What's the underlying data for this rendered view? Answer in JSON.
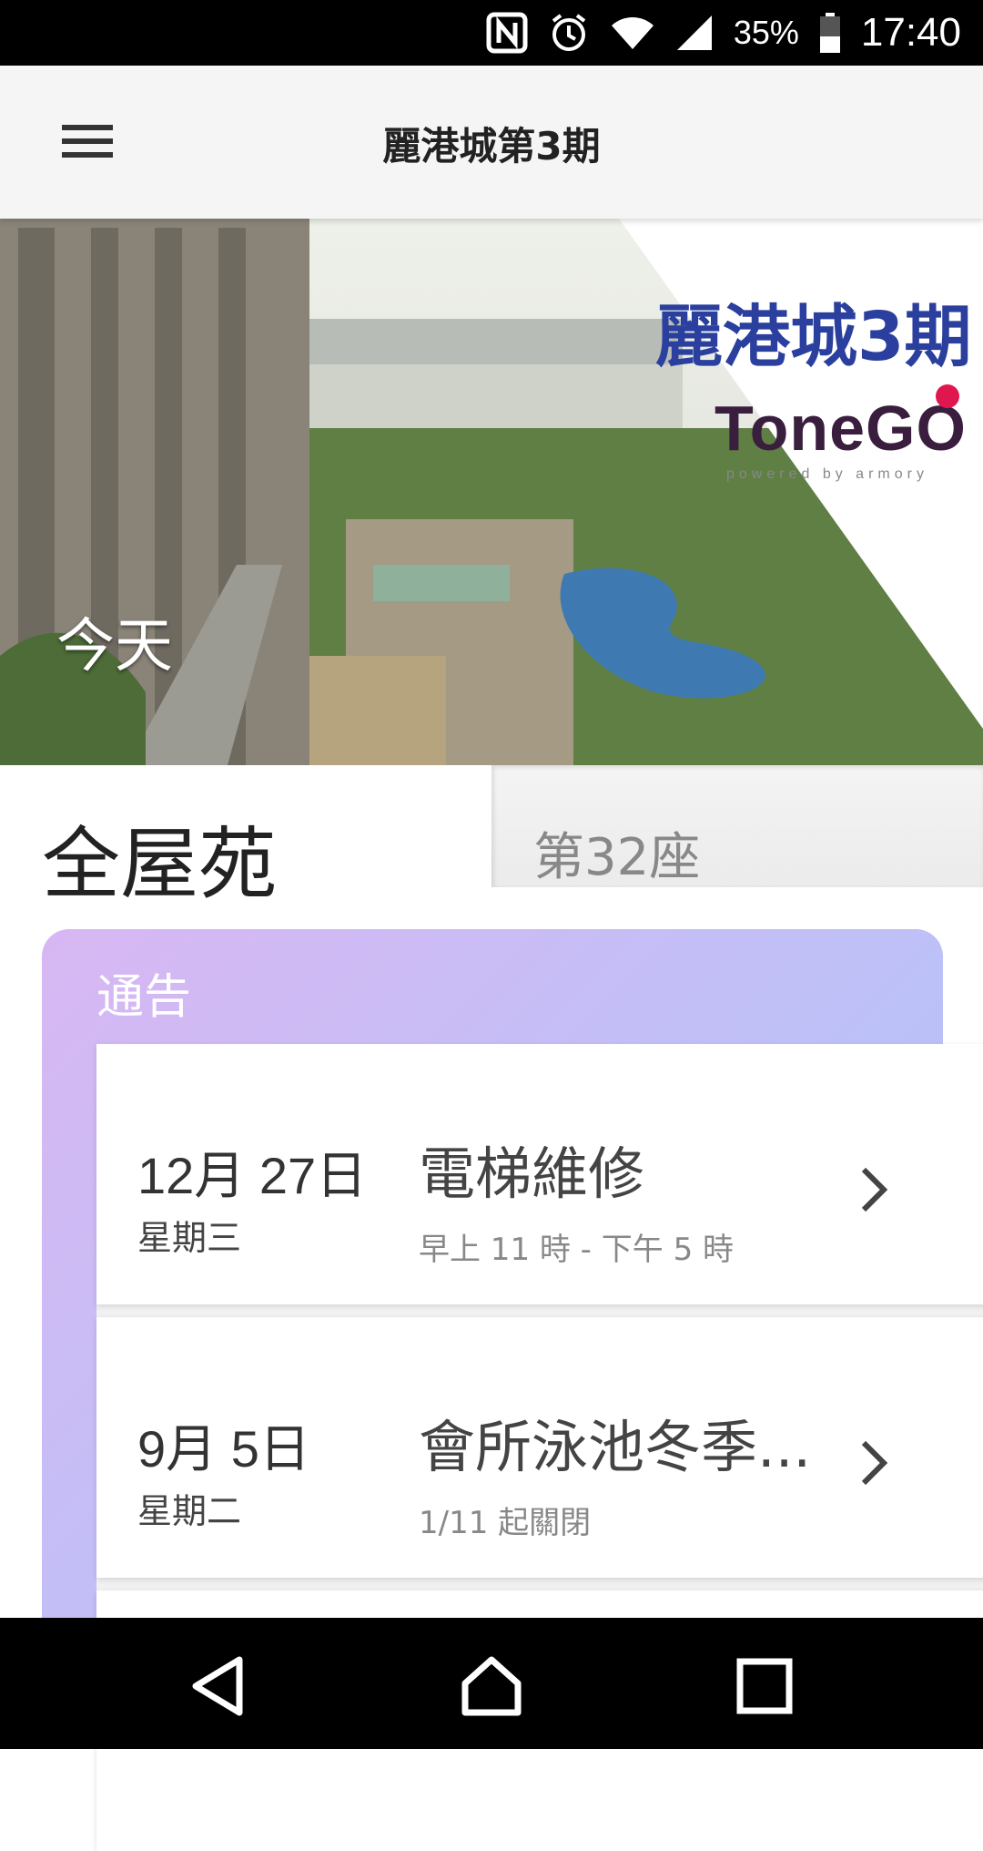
{
  "status_bar": {
    "battery_percent": "35%",
    "time": "17:40",
    "icons": [
      "nfc-icon",
      "alarm-icon",
      "wifi-icon",
      "signal-icon",
      "battery-icon"
    ]
  },
  "app_bar": {
    "title": "麗港城第3期",
    "menu_icon": "menu-icon"
  },
  "hero": {
    "logo_text": "麗港城3期",
    "brand": "ToneGO",
    "brand_tagline": "powered by armory",
    "today_label": "今天"
  },
  "estate": {
    "name": "全屋苑",
    "block_tab": "第32座"
  },
  "notices": {
    "title": "通告",
    "items": [
      {
        "date": "12月 27日",
        "weekday": "星期三",
        "heading": "電梯維修",
        "subtitle": "早上 11 時 - 下午 5 時"
      },
      {
        "date": "9月 5日",
        "weekday": "星期二",
        "heading": "會所泳池冬季...",
        "subtitle": "1/11 起關閉"
      }
    ]
  },
  "nav_bar": {
    "buttons": [
      "back-icon",
      "home-icon",
      "recents-icon"
    ]
  },
  "colors": {
    "card_gradient_start": "#d8b7f3",
    "card_gradient_end": "#a9c2f7",
    "logo_blue": "#2a3f9e",
    "brand_dot": "#e0164e"
  }
}
